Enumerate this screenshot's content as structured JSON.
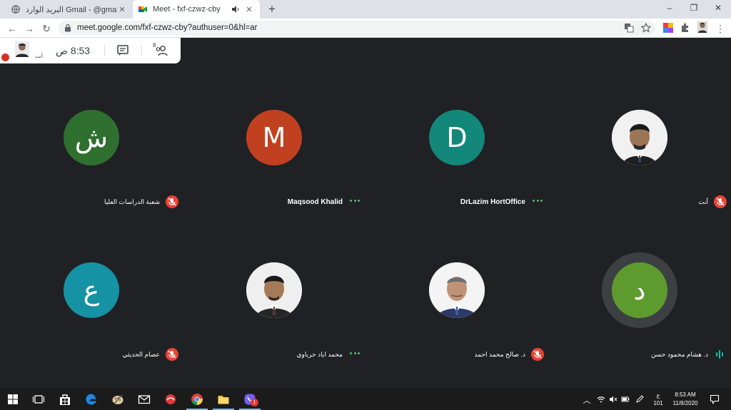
{
  "browser": {
    "tabs": [
      {
        "title": "البريد الوارد Gmail - @gmail.com",
        "active": false
      },
      {
        "title": "Meet - fxf-czwz-cby",
        "active": true
      }
    ],
    "url": "meet.google.com/fxf-czwz-cby?authuser=0&hl=ar",
    "new_tab_label": "+",
    "window_controls": [
      "–",
      "❐",
      "✕"
    ]
  },
  "meet": {
    "self_label": "أنت",
    "clock": "8:53 ص",
    "people_count": "8",
    "participants": [
      {
        "name": "شعبة الدراسات العليا",
        "initial": "ش",
        "color": "#2f6f2f",
        "status": "muted",
        "photo": false
      },
      {
        "name": "Maqsood Khalid",
        "initial": "M",
        "color": "#c1401f",
        "status": "dots",
        "photo": false
      },
      {
        "name": "DrLazim HortOffice",
        "initial": "D",
        "color": "#12877a",
        "status": "dots",
        "photo": false
      },
      {
        "name": "أنت",
        "initial": "",
        "color": "#ffffff",
        "status": "muted",
        "photo": true
      },
      {
        "name": "عصام الحديثي",
        "initial": "ع",
        "color": "#1592a4",
        "status": "muted",
        "photo": false
      },
      {
        "name": "محمد اياد حرباوي",
        "initial": "",
        "color": "#ffffff",
        "status": "dots",
        "photo": true
      },
      {
        "name": "د. صالح محمد احمد",
        "initial": "",
        "color": "#ffffff",
        "status": "muted",
        "photo": true
      },
      {
        "name": "د. هشام محمود حسن",
        "initial": "د",
        "color": "#5e9b2e",
        "status": "talking",
        "photo": false
      }
    ]
  },
  "taskbar": {
    "clock_time": "8:53 AM",
    "clock_date": "11/8/2020",
    "lang_top": "ع",
    "lang_bottom": "101",
    "viber_badge": "1"
  },
  "colors": {
    "meet_bg": "#202124",
    "muted_red": "#ea4335",
    "taskbar": "#1b1b1b"
  }
}
